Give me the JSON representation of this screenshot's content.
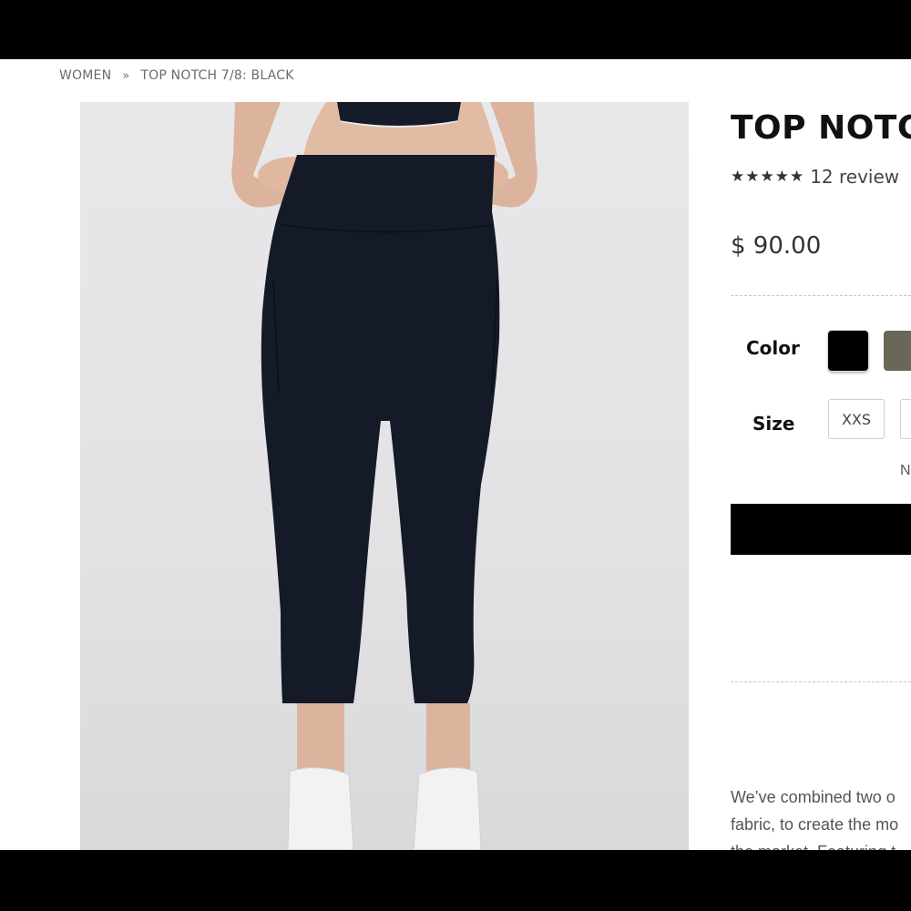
{
  "breadcrumb": {
    "items": [
      "WOMEN",
      "TOP NOTCH 7/8: BLACK"
    ],
    "separator": "»"
  },
  "product": {
    "title": "TOP NOTCH",
    "stars": "★★★★★",
    "rating_value": 5,
    "reviews": "12 review",
    "price": "$ 90.00",
    "color_label": "Color",
    "colors": [
      {
        "name": "black",
        "hex": "#000000",
        "selected": true
      },
      {
        "name": "olive",
        "hex": "#6a6658",
        "selected": false
      }
    ],
    "size_label": "Size",
    "sizes": [
      "XXS",
      ""
    ],
    "size_note": "N",
    "add_to_cart_label": "",
    "description_lines": [
      "We’ve combined two o",
      "fabric, to create the mo",
      "the market. Featuring t"
    ]
  },
  "image": {
    "alt": "Model wearing black high-waisted leggings and white sneakers",
    "legging_color": "#141a28",
    "background_color": "#e4e4e6"
  }
}
